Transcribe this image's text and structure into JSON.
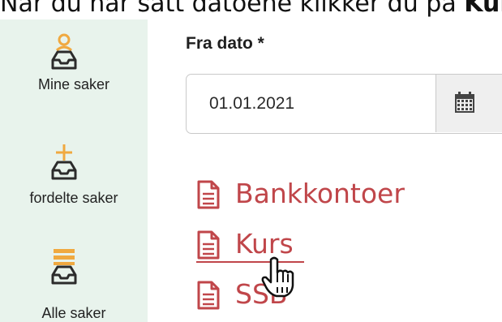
{
  "caption": {
    "prefix": "Når du har satt datoene klikker du på ",
    "bold": "Kurs"
  },
  "sidebar": {
    "items": [
      {
        "label": "Mine saker",
        "icon": "inbox-person-icon"
      },
      {
        "label": "fordelte saker",
        "icon": "inbox-plus-icon"
      },
      {
        "label": "Alle saker",
        "icon": "inbox-stack-icon"
      }
    ]
  },
  "form": {
    "from_date_label": "Fra dato *",
    "from_date_value": "01.01.2021"
  },
  "reports": {
    "links": [
      {
        "label": "Bankkontoer",
        "icon": "document-icon"
      },
      {
        "label": "Kurs",
        "icon": "document-icon"
      },
      {
        "label": "SSB",
        "icon": "document-icon"
      }
    ]
  },
  "colors": {
    "sidebar_bg": "#e8f3ec",
    "icon_orange": "#f0a940",
    "icon_dark": "#2b2b2b",
    "link_red": "#c0464a"
  }
}
